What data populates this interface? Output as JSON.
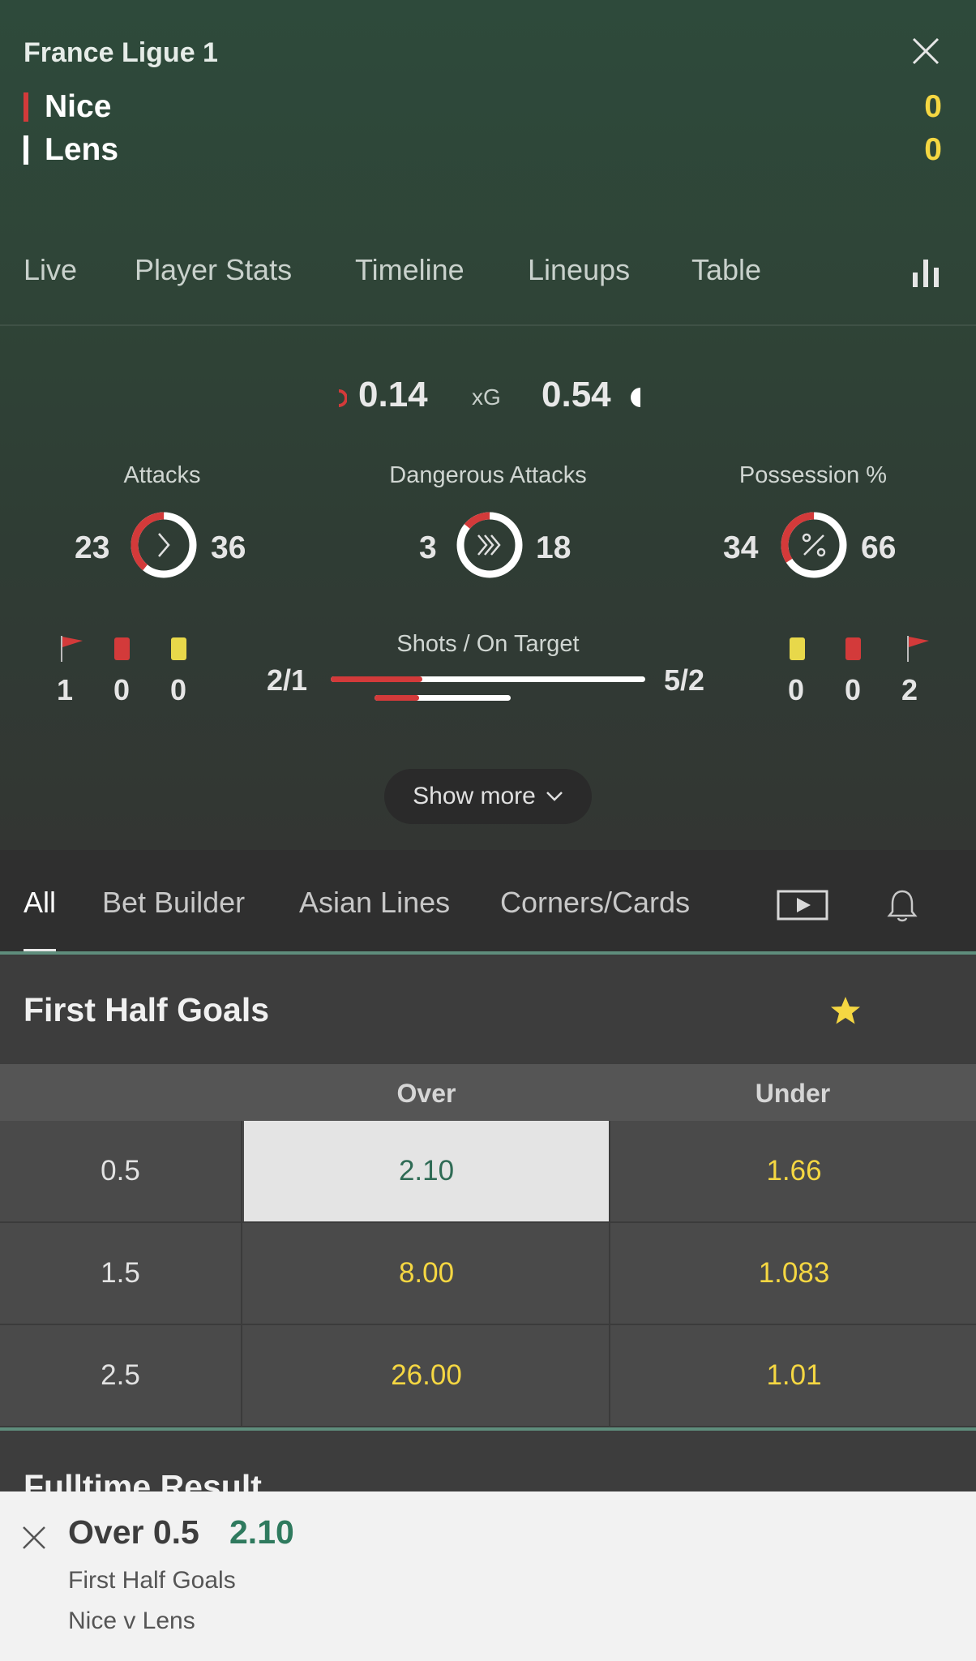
{
  "header": {
    "league": "France Ligue 1",
    "home": {
      "name": "Nice",
      "score": "0",
      "color": "#d33a3a"
    },
    "away": {
      "name": "Lens",
      "score": "0",
      "color": "#ffffff"
    }
  },
  "stat_tabs": [
    "Live",
    "Player Stats",
    "Timeline",
    "Lineups",
    "Table"
  ],
  "xg": {
    "home": "0.14",
    "label": "xG",
    "away": "0.54"
  },
  "metrics": [
    {
      "title": "Attacks",
      "home": "23",
      "away": "36",
      "home_fraction": 0.39,
      "icon": "chevron-right-icon"
    },
    {
      "title": "Dangerous Attacks",
      "home": "3",
      "away": "18",
      "home_fraction": 0.14,
      "icon": "triple-chevron-icon"
    },
    {
      "title": "Possession %",
      "home": "34",
      "away": "66",
      "home_fraction": 0.34,
      "icon": "percent-icon"
    }
  ],
  "home_counts": {
    "corners": "1",
    "red_cards": "0",
    "yellow_cards": "0"
  },
  "away_counts": {
    "yellow_cards": "0",
    "red_cards": "0",
    "corners": "2"
  },
  "shots": {
    "title": "Shots / On Target",
    "home": "2/1",
    "away": "5/2",
    "home_shots_fraction": 0.29,
    "home_on_target_fraction": 0.33
  },
  "show_more": "Show more",
  "market_tabs": [
    "All",
    "Bet Builder",
    "Asian Lines",
    "Corners/Cards"
  ],
  "market": {
    "title": "First Half Goals",
    "columns": [
      "Over",
      "Under"
    ],
    "rows": [
      {
        "line": "0.5",
        "over": "2.10",
        "under": "1.66"
      },
      {
        "line": "1.5",
        "over": "8.00",
        "under": "1.083"
      },
      {
        "line": "2.5",
        "over": "26.00",
        "under": "1.01"
      }
    ]
  },
  "next_market_title": "Fulltime Result",
  "bet_slip": {
    "selection": "Over 0.5",
    "odds": "2.10",
    "market": "First Half Goals",
    "event": "Nice v Lens"
  },
  "colors": {
    "home": "#d33a3a",
    "away": "#ffffff",
    "odds": "#f5d742",
    "accent": "#2f7a5e",
    "yellow_card": "#e8d84a"
  }
}
